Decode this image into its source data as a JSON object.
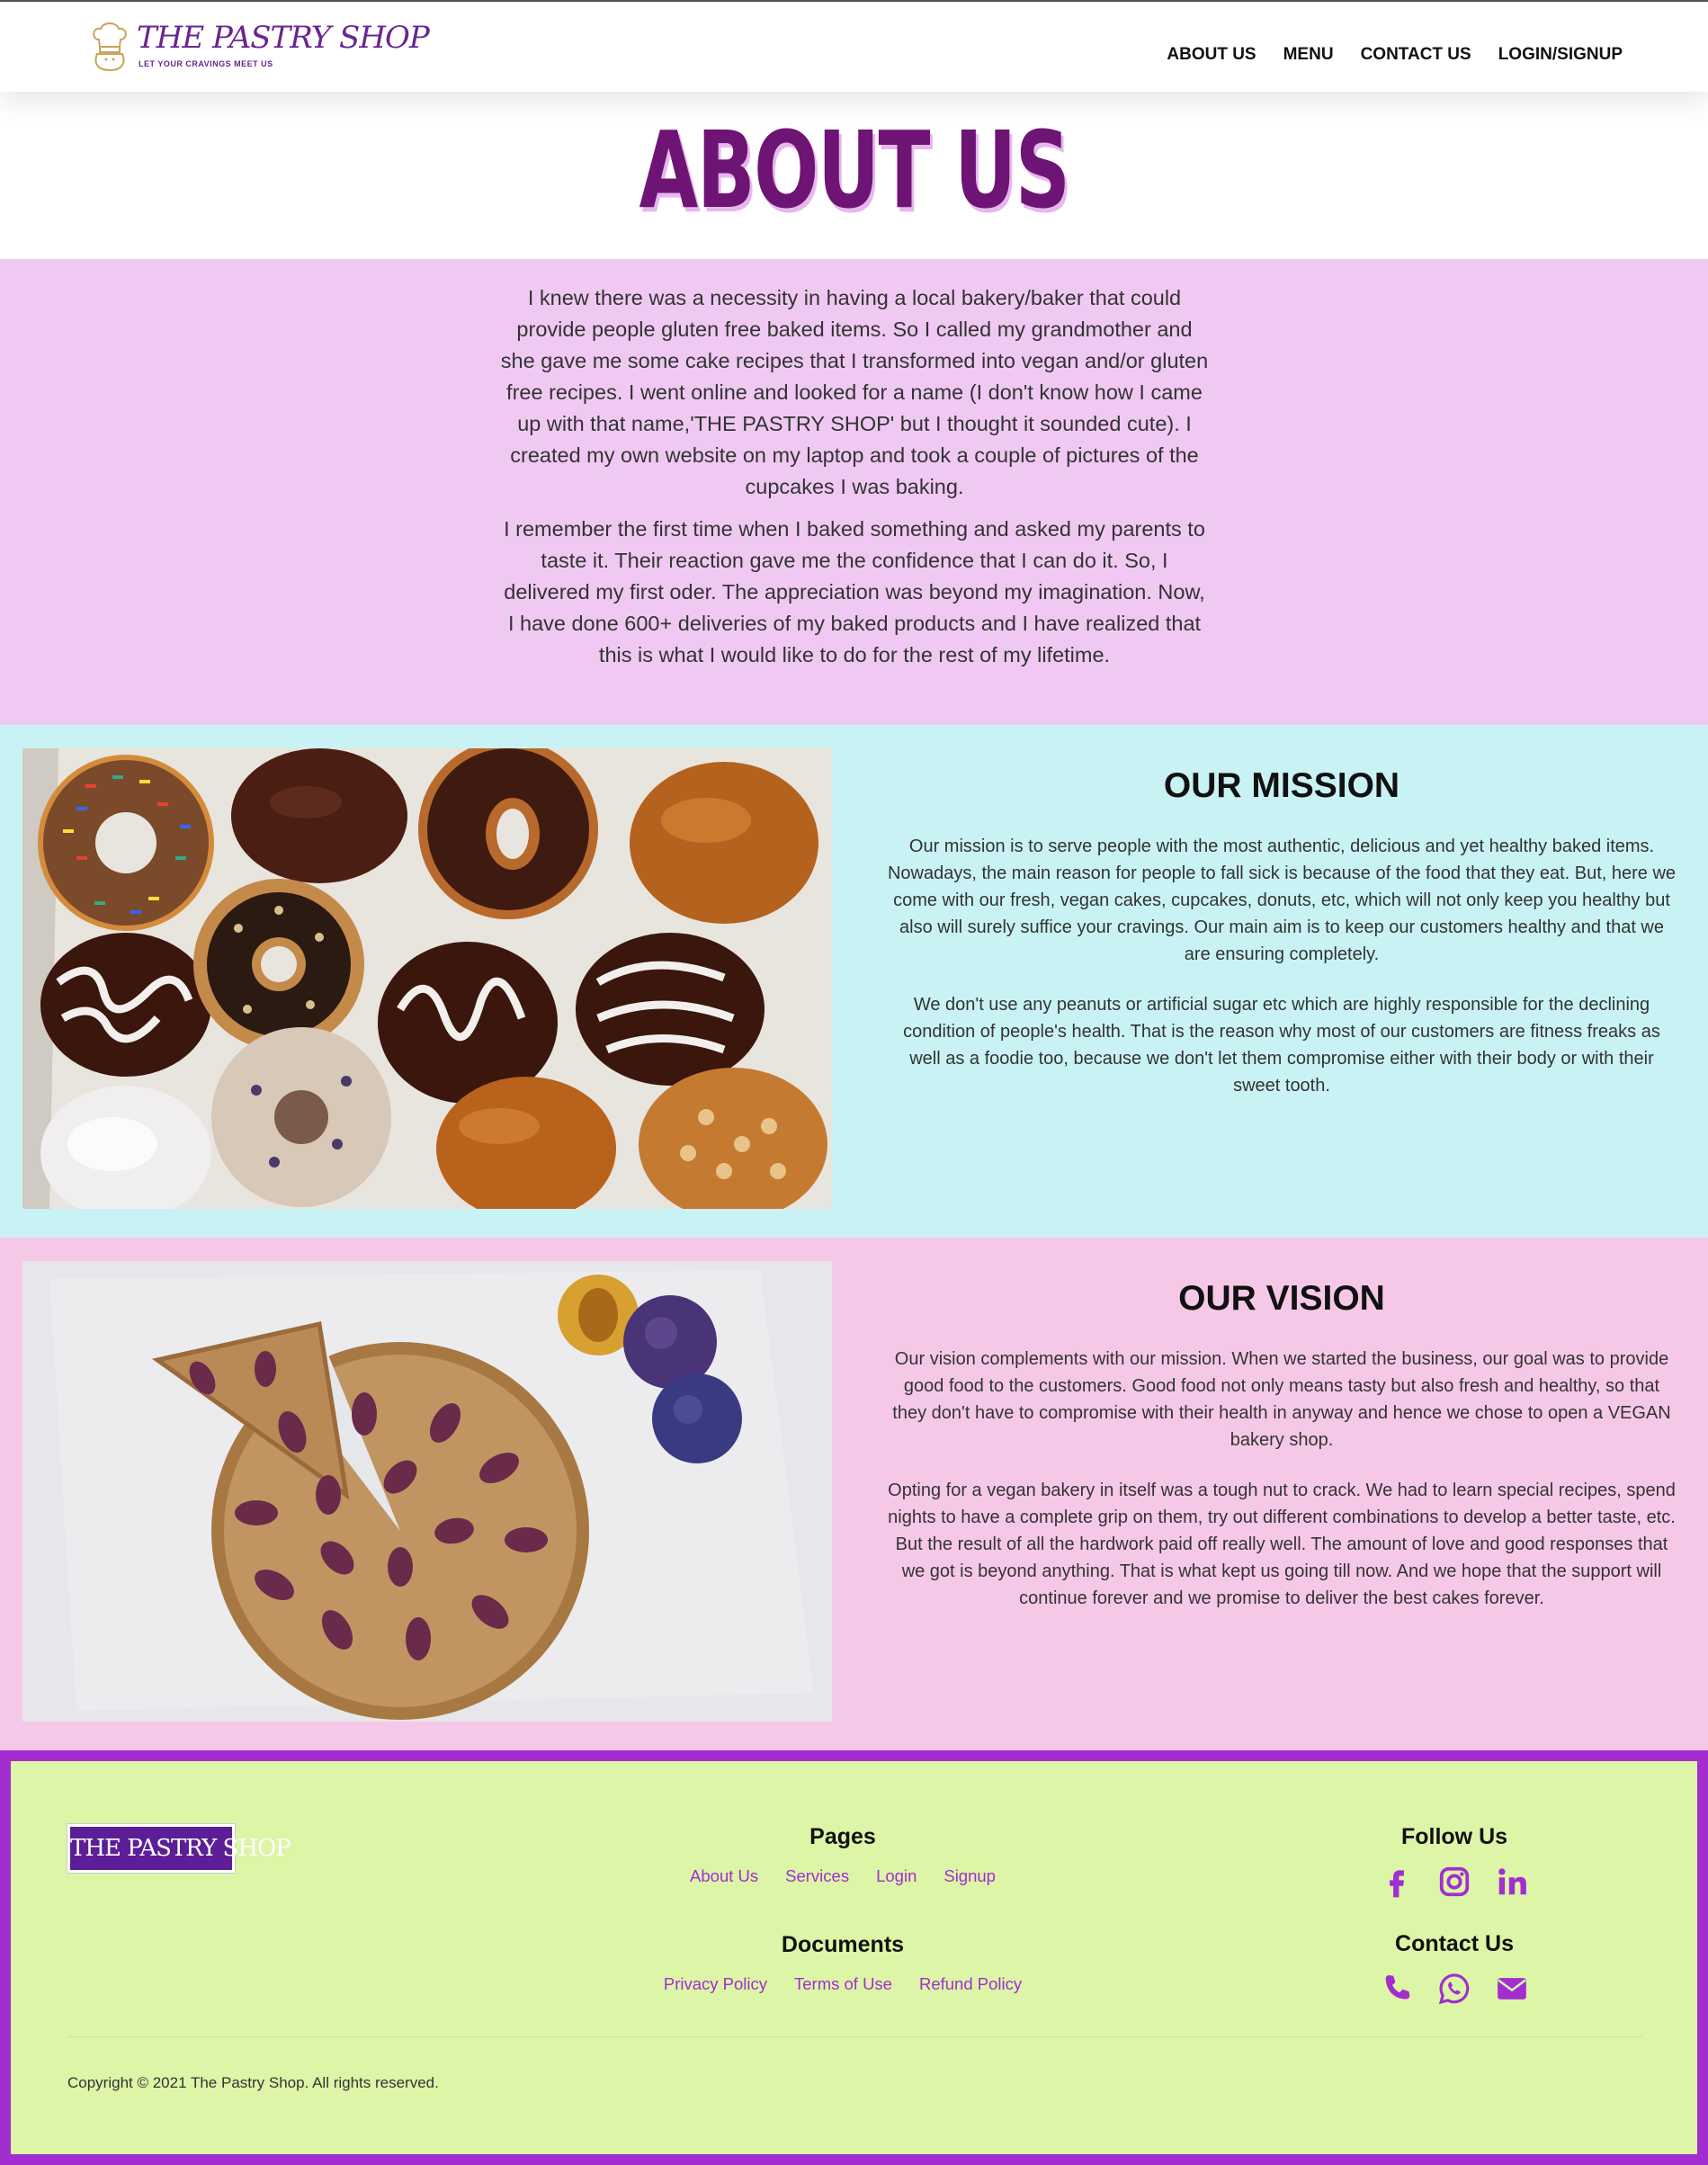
{
  "header": {
    "logo_title": "THE PASTRY SHOP",
    "logo_tagline": "LET YOUR CRAVINGS MEET US",
    "nav": [
      {
        "label": "ABOUT US"
      },
      {
        "label": "MENU"
      },
      {
        "label": "CONTACT US"
      },
      {
        "label": "LOGIN/SIGNUP"
      }
    ]
  },
  "page_title": "ABOUT US",
  "story": {
    "paragraphs": [
      "I knew there was a necessity in having a local bakery/baker that could provide people gluten free baked items. So I called my grandmother and she gave me some cake recipes that I transformed into vegan and/or gluten free recipes. I went online and looked for a name (I don't know how I came up with that name,'THE PASTRY SHOP' but I thought it sounded cute). I created my own website on my laptop and took a couple of pictures of the cupcakes I was baking.",
      "I remember the first time when I baked something and asked my parents to taste it. Their reaction gave me the confidence that I can do it. So, I delivered my first oder. The appreciation was beyond my imagination. Now, I have done 600+ deliveries of my baked products and I have realized that this is what I would like to do for the rest of my lifetime."
    ]
  },
  "mission": {
    "heading": "OUR MISSION",
    "paragraphs": [
      "Our mission is to serve people with the most authentic, delicious and yet healthy baked items. Nowadays, the main reason for people to fall sick is because of the food that they eat. But, here we come with our fresh, vegan cakes, cupcakes, donuts, etc, which will not only keep you healthy but also will surely suffice your cravings. Our main aim is to keep our customers healthy and that we are ensuring completely.",
      "We don't use any peanuts or artificial sugar etc which are highly responsible for the declining condition of people's health. That is the reason why most of our customers are fitness freaks as well as a foodie too, because we don't let them compromise either with their body or with their sweet tooth."
    ]
  },
  "vision": {
    "heading": "OUR VISION",
    "paragraphs": [
      "Our vision complements with our mission. When we started the business, our goal was to provide good food to the customers. Good food not only means tasty but also fresh and healthy, so that they don't have to compromise with their health in anyway and hence we chose to open a VEGAN bakery shop.",
      "Opting for a vegan bakery in itself was a tough nut to crack. We had to learn special recipes, spend nights to have a complete grip on them, try out different combinations to develop a better taste, etc. But the result of all the hardwork paid off really well. The amount of love and good responses that we got is beyond anything. That is what kept us going till now. And we hope that the support will continue forever and we promise to deliver the best cakes forever."
    ]
  },
  "footer": {
    "logo_text": "THE PASTRY SHOP",
    "pages_heading": "Pages",
    "pages_links": [
      {
        "label": "About Us"
      },
      {
        "label": "Services"
      },
      {
        "label": "Login"
      },
      {
        "label": "Signup"
      }
    ],
    "documents_heading": "Documents",
    "documents_links": [
      {
        "label": "Privacy Policy"
      },
      {
        "label": "Terms of Use"
      },
      {
        "label": "Refund Policy"
      }
    ],
    "follow_heading": "Follow Us",
    "follow_icons": [
      "facebook-icon",
      "instagram-icon",
      "linkedin-icon"
    ],
    "contact_heading": "Contact Us",
    "contact_icons": [
      "phone-icon",
      "whatsapp-icon",
      "email-icon"
    ],
    "copyright": "Copyright © 2021 The Pastry Shop. All rights reserved."
  },
  "colors": {
    "brand_purple": "#6a2591",
    "title_purple": "#6e1474",
    "story_bg": "#f0c9f3",
    "mission_bg": "#c9f2f4",
    "vision_bg": "#f6c8e8",
    "footer_border": "#a22ed0",
    "footer_bg": "#dcf5a6",
    "link_color": "#a22ed0"
  }
}
